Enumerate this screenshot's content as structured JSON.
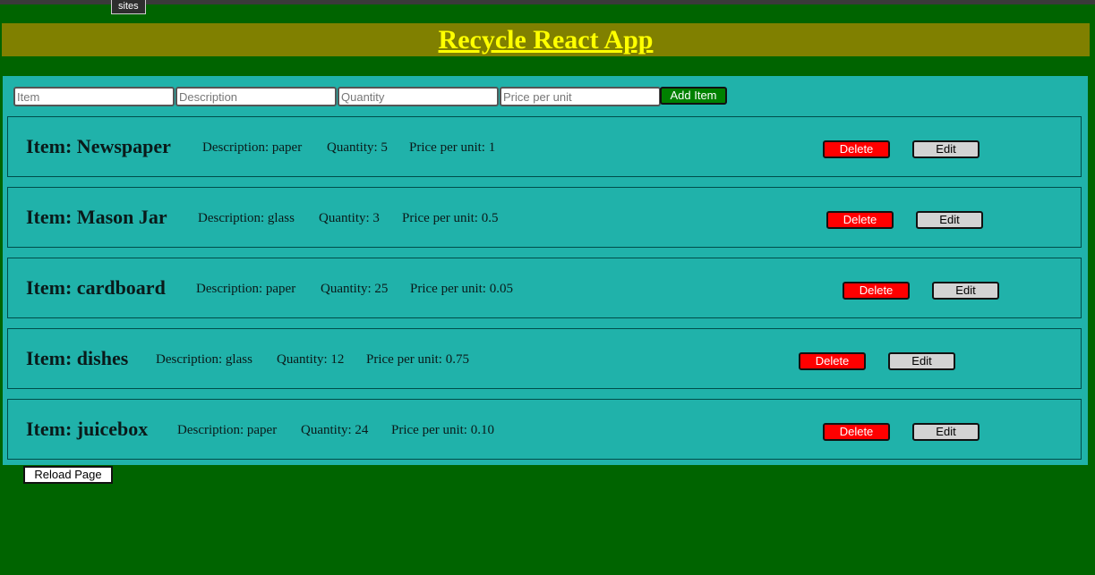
{
  "browser": {
    "tab_label": "sites"
  },
  "header": {
    "title": "Recycle React App"
  },
  "form": {
    "item_placeholder": "Item",
    "description_placeholder": "Description",
    "quantity_placeholder": "Quantity",
    "price_placeholder": "Price per unit",
    "add_label": "Add Item"
  },
  "items": [
    {
      "name": "Item: Newspaper",
      "description": "Description: paper",
      "quantity": "Quantity: 5",
      "price": "Price per unit: 1",
      "delete_label": "Delete",
      "edit_label": "Edit"
    },
    {
      "name": "Item: Mason Jar",
      "description": "Description: glass",
      "quantity": "Quantity: 3",
      "price": "Price per unit: 0.5",
      "delete_label": "Delete",
      "edit_label": "Edit"
    },
    {
      "name": "Item: cardboard",
      "description": "Description: paper",
      "quantity": "Quantity: 25",
      "price": "Price per unit: 0.05",
      "delete_label": "Delete",
      "edit_label": "Edit"
    },
    {
      "name": "Item: dishes",
      "description": "Description: glass",
      "quantity": "Quantity: 12",
      "price": "Price per unit: 0.75",
      "delete_label": "Delete",
      "edit_label": "Edit"
    },
    {
      "name": "Item: juicebox",
      "description": "Description: paper",
      "quantity": "Quantity: 24",
      "price": "Price per unit: 0.10",
      "delete_label": "Delete",
      "edit_label": "Edit"
    }
  ],
  "footer": {
    "reload_label": "Reload Page"
  },
  "colors": {
    "page_bg": "#006400",
    "header_bg": "#808000",
    "title_color": "#ffff00",
    "panel_bg": "#20b2aa",
    "add_button": "#008000",
    "delete_button": "#ff0000",
    "edit_button": "#d3d3d3"
  }
}
